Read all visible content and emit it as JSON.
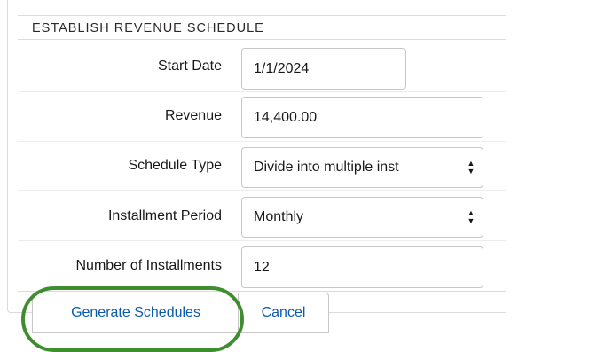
{
  "section": {
    "title": "ESTABLISH REVENUE SCHEDULE"
  },
  "fields": {
    "start_date": {
      "label": "Start Date",
      "value": "1/1/2024"
    },
    "revenue": {
      "label": "Revenue",
      "value": "14,400.00"
    },
    "schedule_type": {
      "label": "Schedule Type",
      "value": "Divide into multiple inst"
    },
    "installment_period": {
      "label": "Installment Period",
      "value": "Monthly"
    },
    "number_of_installments": {
      "label": "Number of Installments",
      "value": "12"
    }
  },
  "buttons": {
    "generate_label": "Generate Schedules",
    "cancel_label": "Cancel"
  },
  "colors": {
    "link_blue": "#0b5cab",
    "highlight_green": "#3e8e2f",
    "border_gray": "#c9c7c5"
  },
  "icons": {
    "stepper_up": "▲",
    "stepper_down": "▼"
  }
}
